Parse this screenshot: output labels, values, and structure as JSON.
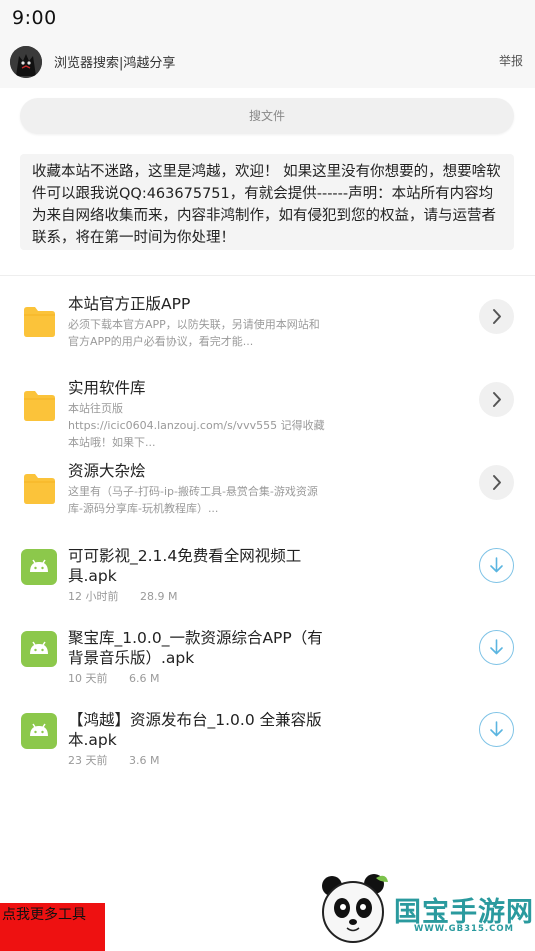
{
  "status_bar": {
    "time": "9:00"
  },
  "header": {
    "title": "浏览器搜索|鸿越分享",
    "report": "举报"
  },
  "search": {
    "label": "搜文件"
  },
  "notice": "收藏本站不迷路，这里是鸿越，欢迎！ 如果这里没有你想要的，想要啥软件可以跟我说QQ:463675751，有就会提供------声明：本站所有内容均为来自网络收集而来，内容非鸿制作，如有侵犯到您的权益，请与运营者联系，将在第一时间为你处理！",
  "folders": [
    {
      "title": "本站官方正版APP",
      "desc": "必须下载本官方APP，以防失联，另请使用本网站和官方APP的用户必看协议，看完才能..."
    },
    {
      "title": "实用软件库",
      "desc": "本站往页版 https://icic0604.lanzouj.com/s/vvv555 记得收藏本站哦！如果下..."
    },
    {
      "title": "资源大杂烩",
      "desc": "这里有（马子-打码-ip-搬砖工具-悬赏合集-游戏资源库-源码分享库-玩机教程库）..."
    }
  ],
  "files": [
    {
      "title": "可可影视_2.1.4免费看全网视频工具.apk",
      "time": "12 小时前",
      "size": "28.9 M"
    },
    {
      "title": "聚宝库_1.0.0_一款资源综合APP（有背景音乐版）.apk",
      "time": "10 天前",
      "size": "6.6 M"
    },
    {
      "title": "【鸿越】资源发布台_1.0.0 全兼容版本.apk",
      "time": "23 天前",
      "size": "3.6 M"
    }
  ],
  "promo": {
    "label": "点我更多工具"
  },
  "watermark": {
    "brand": "国宝手游网",
    "url": "WWW.GB315.COM"
  },
  "colors": {
    "folder": "#fbc33a",
    "android": "#8cc84b",
    "download": "#5bb5e0",
    "promo": "#ee1111",
    "watermark": "#2a9a9e"
  },
  "icons": {
    "folder": "folder-icon",
    "apk": "android-icon",
    "chevron": "chevron-right-icon",
    "download": "download-icon"
  }
}
